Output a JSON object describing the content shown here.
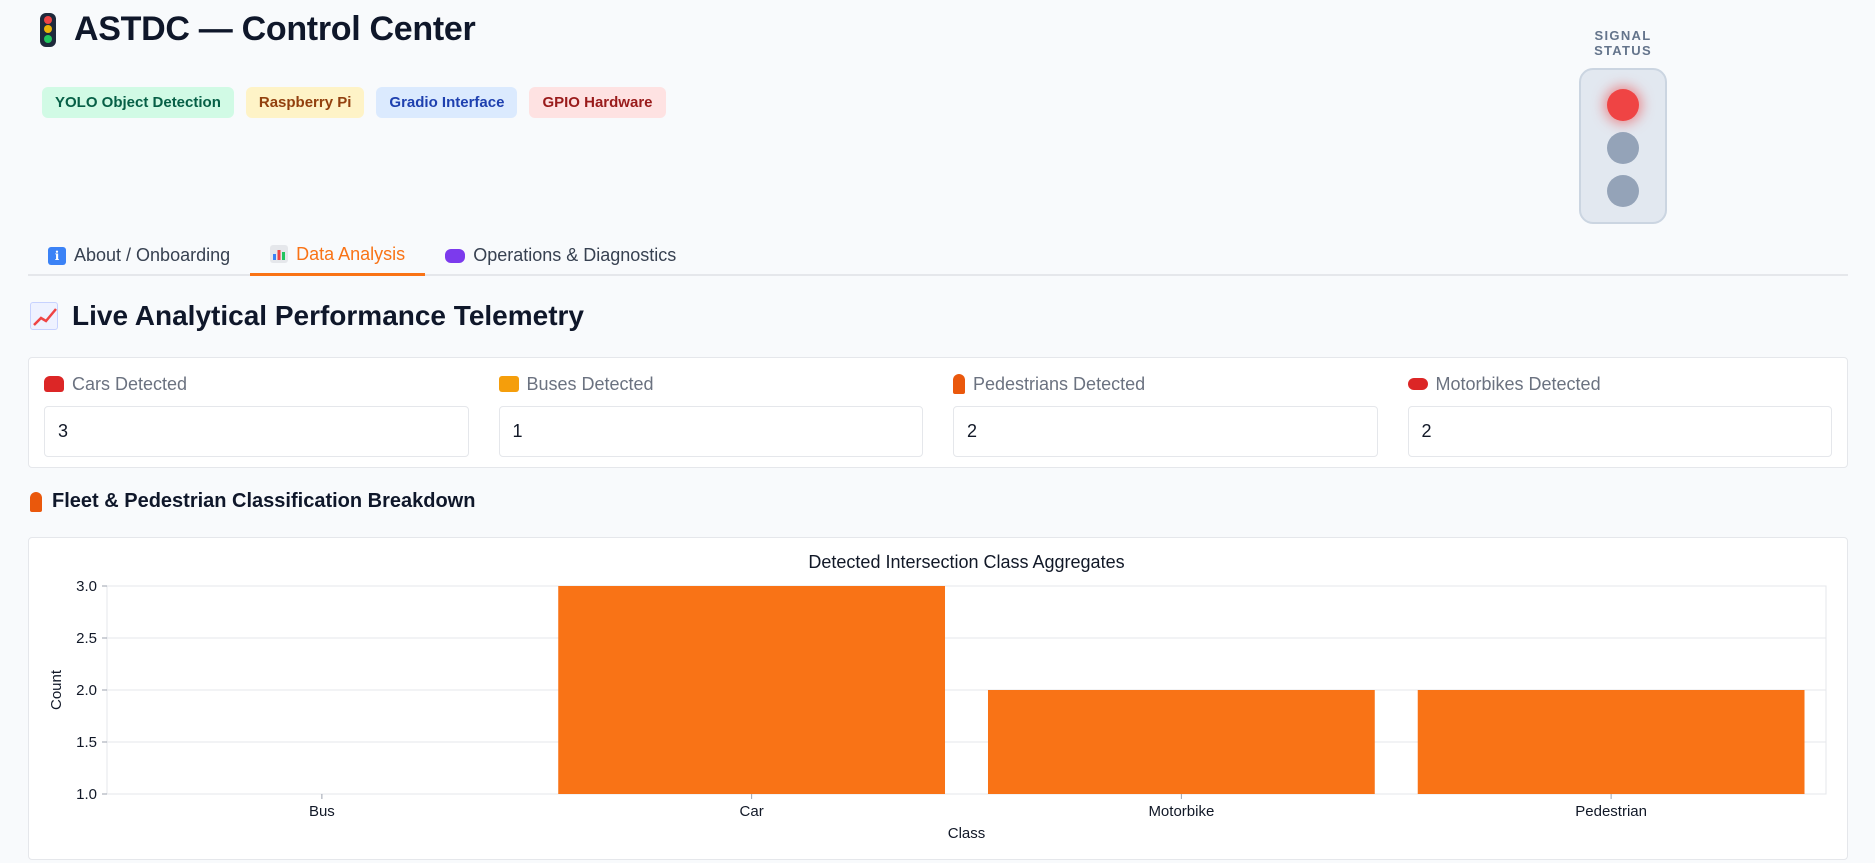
{
  "header": {
    "title": "ASTDC — Control Center",
    "logo_icon": "traffic-light-icon",
    "badges": [
      {
        "label": "YOLO Object Detection",
        "tone": "green"
      },
      {
        "label": "Raspberry Pi",
        "tone": "yellow"
      },
      {
        "label": "Gradio Interface",
        "tone": "blue"
      },
      {
        "label": "GPIO Hardware",
        "tone": "red"
      }
    ]
  },
  "signal": {
    "label": "SIGNAL STATUS",
    "active_light": "red",
    "colors": {
      "on_red": "#ef4444",
      "off": "#94a3b8"
    }
  },
  "tabs": [
    {
      "label": "About / Onboarding",
      "icon": "info-icon",
      "active": false
    },
    {
      "label": "Data Analysis",
      "icon": "bar-chart-icon",
      "active": true
    },
    {
      "label": "Operations & Diagnostics",
      "icon": "gamepad-icon",
      "active": false
    }
  ],
  "analysis": {
    "section_title": "Live Analytical Performance Telemetry",
    "section_icon": "chart-increasing-icon",
    "metrics": [
      {
        "label": "Cars Detected",
        "icon": "car-icon",
        "value": "3"
      },
      {
        "label": "Buses Detected",
        "icon": "bus-icon",
        "value": "1"
      },
      {
        "label": "Pedestrians Detected",
        "icon": "pedestrian-icon",
        "value": "2"
      },
      {
        "label": "Motorbikes Detected",
        "icon": "motorbike-icon",
        "value": "2"
      }
    ],
    "breakdown_title": "Fleet & Pedestrian Classification Breakdown",
    "breakdown_icon": "pedestrian-icon"
  },
  "theme": {
    "accent": "#f97316",
    "bar": "#f97316"
  },
  "chart_data": {
    "type": "bar",
    "title": "Detected Intersection Class Aggregates",
    "xlabel": "Class",
    "ylabel": "Count",
    "categories": [
      "Bus",
      "Car",
      "Motorbike",
      "Pedestrian"
    ],
    "values": [
      1,
      3,
      2,
      2
    ],
    "ylim": [
      1,
      3
    ],
    "yticks": [
      "1.0",
      "1.5",
      "2.0",
      "2.5",
      "3.0"
    ],
    "grid": true
  }
}
